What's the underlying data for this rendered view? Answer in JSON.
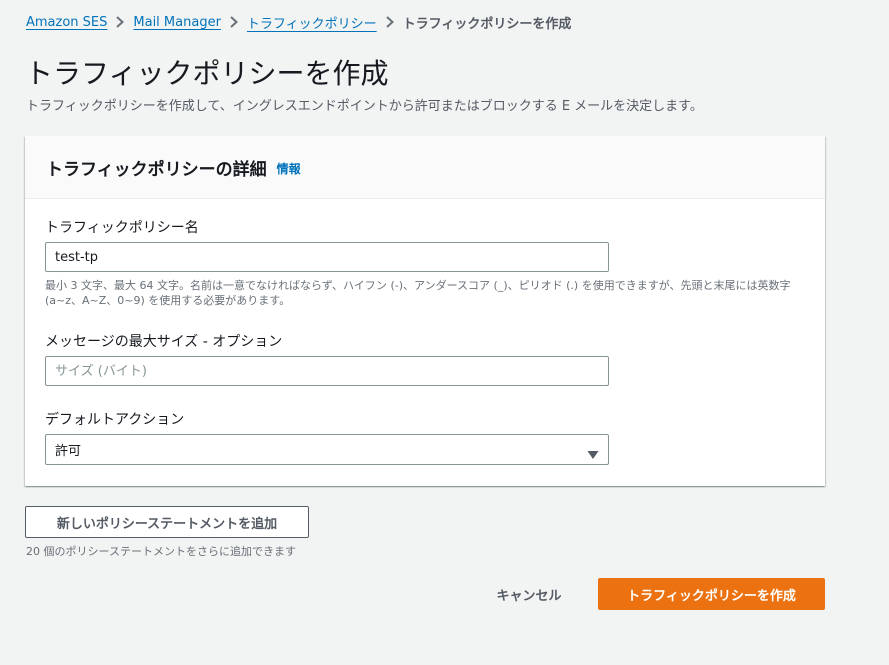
{
  "breadcrumb": {
    "items": [
      "Amazon SES",
      "Mail Manager",
      "トラフィックポリシー"
    ],
    "current": "トラフィックポリシーを作成"
  },
  "page": {
    "title": "トラフィックポリシーを作成",
    "description": "トラフィックポリシーを作成して、イングレスエンドポイントから許可またはブロックする E メールを決定します。"
  },
  "panel": {
    "title": "トラフィックポリシーの詳細",
    "info_link": "情報",
    "name_field": {
      "label": "トラフィックポリシー名",
      "value": "test-tp",
      "constraint": "最小 3 文字、最大 64 文字。名前は一意でなければならず、ハイフン (-)、アンダースコア (_)、ピリオド (.) を使用できますが、先頭と末尾には英数字 (a~z、A~Z、0~9) を使用する必要があります。"
    },
    "size_field": {
      "label": "メッセージの最大サイズ - オプション",
      "value": "",
      "placeholder": "サイズ (バイト)"
    },
    "action_field": {
      "label": "デフォルトアクション",
      "selected": "許可"
    }
  },
  "actions": {
    "add_statement_label": "新しいポリシーステートメントを追加",
    "add_statement_hint": "20 個のポリシーステートメントをさらに追加できます",
    "cancel_label": "キャンセル",
    "create_label": "トラフィックポリシーを作成"
  },
  "icons": {
    "breadcrumb_separator": "chevron-right-icon",
    "select_caret": "caret-down-icon"
  },
  "colors": {
    "link": "#0073bb",
    "primary_button": "#ec7211",
    "background": "#f2f3f3"
  }
}
